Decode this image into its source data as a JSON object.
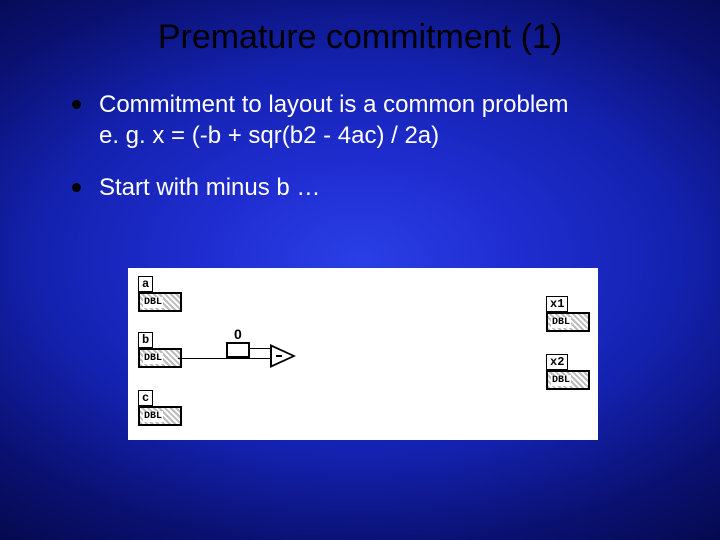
{
  "title": "Premature commitment (1)",
  "bullets": [
    {
      "line1": "Commitment to layout is a common problem",
      "line2": "e. g.  x = (-b + sqr(b2 - 4ac) / 2a)"
    },
    {
      "line1": "Start with minus b …"
    }
  ],
  "diagram": {
    "inputs": [
      {
        "label": "a",
        "type": "DBL"
      },
      {
        "label": "b",
        "type": "DBL"
      },
      {
        "label": "c",
        "type": "DBL"
      }
    ],
    "outputs": [
      {
        "label": "x1",
        "type": "DBL"
      },
      {
        "label": "x2",
        "type": "DBL"
      }
    ],
    "const_zero": "0",
    "op": "−"
  }
}
